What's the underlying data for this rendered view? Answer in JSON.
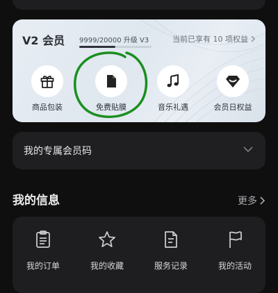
{
  "member": {
    "level_title": "V2 会员",
    "progress_text": "9999/20000 升级 V3",
    "progress_fraction": 0.5,
    "benefit_count_text": "当前已享有 10 项权益",
    "benefits": [
      {
        "label": "商品包装",
        "icon": "gift-icon"
      },
      {
        "label": "免费贴膜",
        "icon": "document-icon"
      },
      {
        "label": "音乐礼遇",
        "icon": "music-note-icon"
      },
      {
        "label": "会员日权益",
        "icon": "diamond-icon"
      }
    ],
    "annotation_color": "#1a8f1f"
  },
  "member_code": {
    "label": "我的专属会员码"
  },
  "my_info": {
    "title": "我的信息",
    "more_label": "更多",
    "items": [
      {
        "label": "我的订单",
        "icon": "order-list-icon"
      },
      {
        "label": "我的收藏",
        "icon": "star-icon"
      },
      {
        "label": "服务记录",
        "icon": "service-record-icon"
      },
      {
        "label": "我的活动",
        "icon": "flag-icon"
      }
    ]
  },
  "colors": {
    "background": "#0f0f10",
    "card": "#1e1e20",
    "member_card": "#e3e9f0"
  }
}
